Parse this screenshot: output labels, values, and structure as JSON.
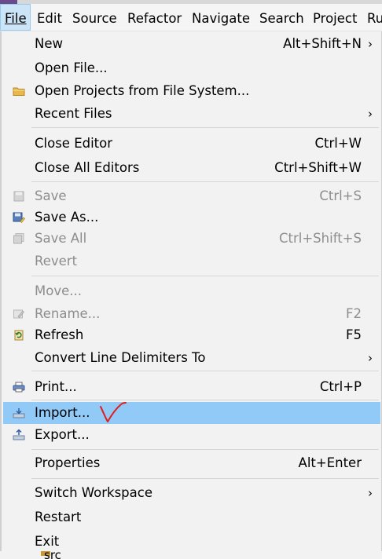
{
  "menubar": [
    {
      "id": "file",
      "label": "File"
    },
    {
      "id": "edit",
      "label": "Edit"
    },
    {
      "id": "source",
      "label": "Source"
    },
    {
      "id": "refactor",
      "label": "Refactor"
    },
    {
      "id": "navigate",
      "label": "Navigate"
    },
    {
      "id": "search",
      "label": "Search"
    },
    {
      "id": "project",
      "label": "Project"
    },
    {
      "id": "run",
      "label": "Ru"
    }
  ],
  "menu": {
    "items": [
      {
        "label": "New",
        "accel": "Alt+Shift+N",
        "submenu": true,
        "enabled": true,
        "icon": null
      },
      {
        "label": "Open File...",
        "accel": "",
        "enabled": true,
        "icon": null
      },
      {
        "label": "Open Projects from File System...",
        "accel": "",
        "enabled": true,
        "icon": "folder-icon"
      },
      {
        "label": "Recent Files",
        "accel": "",
        "submenu": true,
        "enabled": true,
        "icon": null
      },
      {
        "label": "Close Editor",
        "accel": "Ctrl+W",
        "enabled": true,
        "icon": null
      },
      {
        "label": "Close All Editors",
        "accel": "Ctrl+Shift+W",
        "enabled": true,
        "icon": null
      },
      {
        "label": "Save",
        "accel": "Ctrl+S",
        "enabled": false,
        "icon": "save-icon"
      },
      {
        "label": "Save As...",
        "accel": "",
        "enabled": true,
        "icon": "save-as-icon"
      },
      {
        "label": "Save All",
        "accel": "Ctrl+Shift+S",
        "enabled": false,
        "icon": "save-all-icon"
      },
      {
        "label": "Revert",
        "accel": "",
        "enabled": false,
        "icon": null
      },
      {
        "label": "Move...",
        "accel": "",
        "enabled": false,
        "icon": null
      },
      {
        "label": "Rename...",
        "accel": "F2",
        "enabled": false,
        "icon": "rename-icon"
      },
      {
        "label": "Refresh",
        "accel": "F5",
        "enabled": true,
        "icon": "refresh-icon"
      },
      {
        "label": "Convert Line Delimiters To",
        "accel": "",
        "submenu": true,
        "enabled": true,
        "icon": null
      },
      {
        "label": "Print...",
        "accel": "Ctrl+P",
        "enabled": true,
        "icon": "print-icon"
      },
      {
        "label": "Import...",
        "accel": "",
        "enabled": true,
        "highlighted": true,
        "icon": "import-icon"
      },
      {
        "label": "Export...",
        "accel": "",
        "enabled": true,
        "icon": "export-icon"
      },
      {
        "label": "Properties",
        "accel": "Alt+Enter",
        "enabled": true,
        "icon": null
      },
      {
        "label": "Switch Workspace",
        "accel": "",
        "submenu": true,
        "enabled": true,
        "icon": null
      },
      {
        "label": "Restart",
        "accel": "",
        "enabled": true,
        "icon": null
      },
      {
        "label": "Exit",
        "accel": "",
        "enabled": true,
        "icon": null
      }
    ]
  },
  "colors": {
    "highlight": "#91c9f7",
    "annotation": "#e0201c",
    "disabled_text": "#8d8d8d"
  },
  "annotation": {
    "name": "red-checkmark",
    "color": "#e0201c"
  },
  "behind_fragment": "src"
}
